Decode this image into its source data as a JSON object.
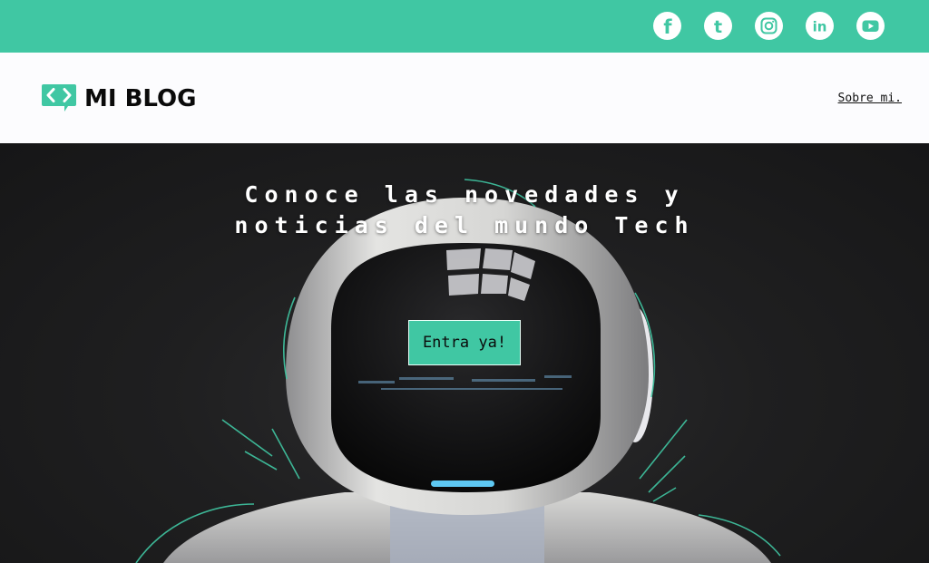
{
  "topbar": {
    "bg_color": "#40c7a3",
    "social_links": [
      {
        "name": "facebook",
        "icon": "facebook-icon",
        "glyph": "f"
      },
      {
        "name": "tumblr",
        "icon": "tumblr-icon",
        "glyph": "t"
      },
      {
        "name": "instagram",
        "icon": "instagram-icon"
      },
      {
        "name": "linkedin",
        "icon": "linkedin-icon",
        "glyph": "in"
      },
      {
        "name": "youtube",
        "icon": "youtube-icon"
      }
    ]
  },
  "header": {
    "logo_text": "MI BLOG",
    "logo_icon": "code-bubble-icon",
    "nav_link": "Sobre mi."
  },
  "hero": {
    "title_line1": "Conoce las novedades y",
    "title_line2": "noticias del mundo Tech",
    "cta_label": "Entra ya!",
    "accent_color": "#40c7a3"
  }
}
